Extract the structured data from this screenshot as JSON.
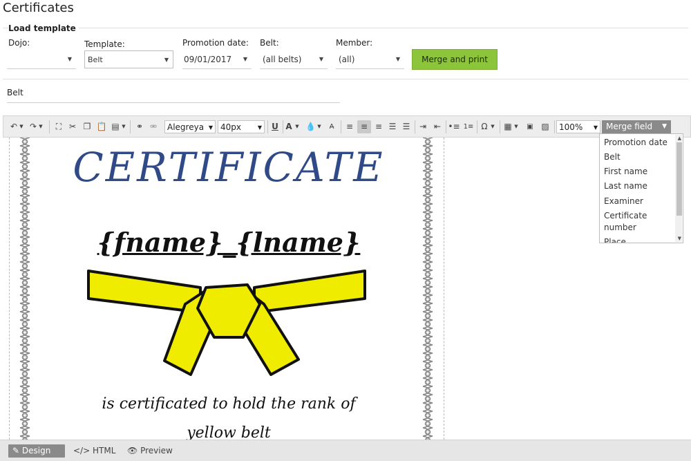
{
  "page": {
    "title": "Certificates"
  },
  "load_template": {
    "title": "Load template",
    "dojo": {
      "label": "Dojo:",
      "value": ""
    },
    "template": {
      "label": "Template:",
      "value": "Belt"
    },
    "promotion_date": {
      "label": "Promotion date:",
      "value": "09/01/2017"
    },
    "belt": {
      "label": "Belt:",
      "value": "(all belts)"
    },
    "member": {
      "label": "Member:",
      "value": "(all)"
    },
    "merge_button": "Merge and print"
  },
  "template_name": "Belt",
  "toolbar": {
    "font_family": "Alegreya",
    "font_size": "40px",
    "zoom": "100%",
    "merge_field": "Merge field",
    "icons": [
      "undo-icon",
      "redo-icon",
      "select-all-icon",
      "cut-icon",
      "copy-icon",
      "paste-icon",
      "paste-options-icon",
      "link-icon",
      "unlink-icon",
      "underline-icon",
      "font-color-icon",
      "highlight-icon",
      "clear-format-icon",
      "align-left-icon",
      "align-center-icon",
      "align-right-icon",
      "justify-icon",
      "justify-full-icon",
      "indent-icon",
      "outdent-icon",
      "bullet-list-icon",
      "numbered-list-icon",
      "symbol-icon",
      "table-icon",
      "insert-template-icon",
      "image-icon"
    ]
  },
  "merge_fields": [
    "Promotion date",
    "Belt",
    "First name",
    "Last name",
    "Examiner",
    "Certificate number",
    "Place"
  ],
  "certificate": {
    "title": "CERTIFICATE",
    "fname": "{fname}",
    "sep": "_",
    "lname": "{lname}",
    "line1": "is certificated to hold the rank of",
    "line2": "yellow belt",
    "belt_color": "#f0ec00"
  },
  "modes": {
    "design": "Design",
    "html": "HTML",
    "preview": "Preview"
  },
  "colors": {
    "accent_green": "#8cc43b",
    "title_blue": "#2f4a86"
  }
}
